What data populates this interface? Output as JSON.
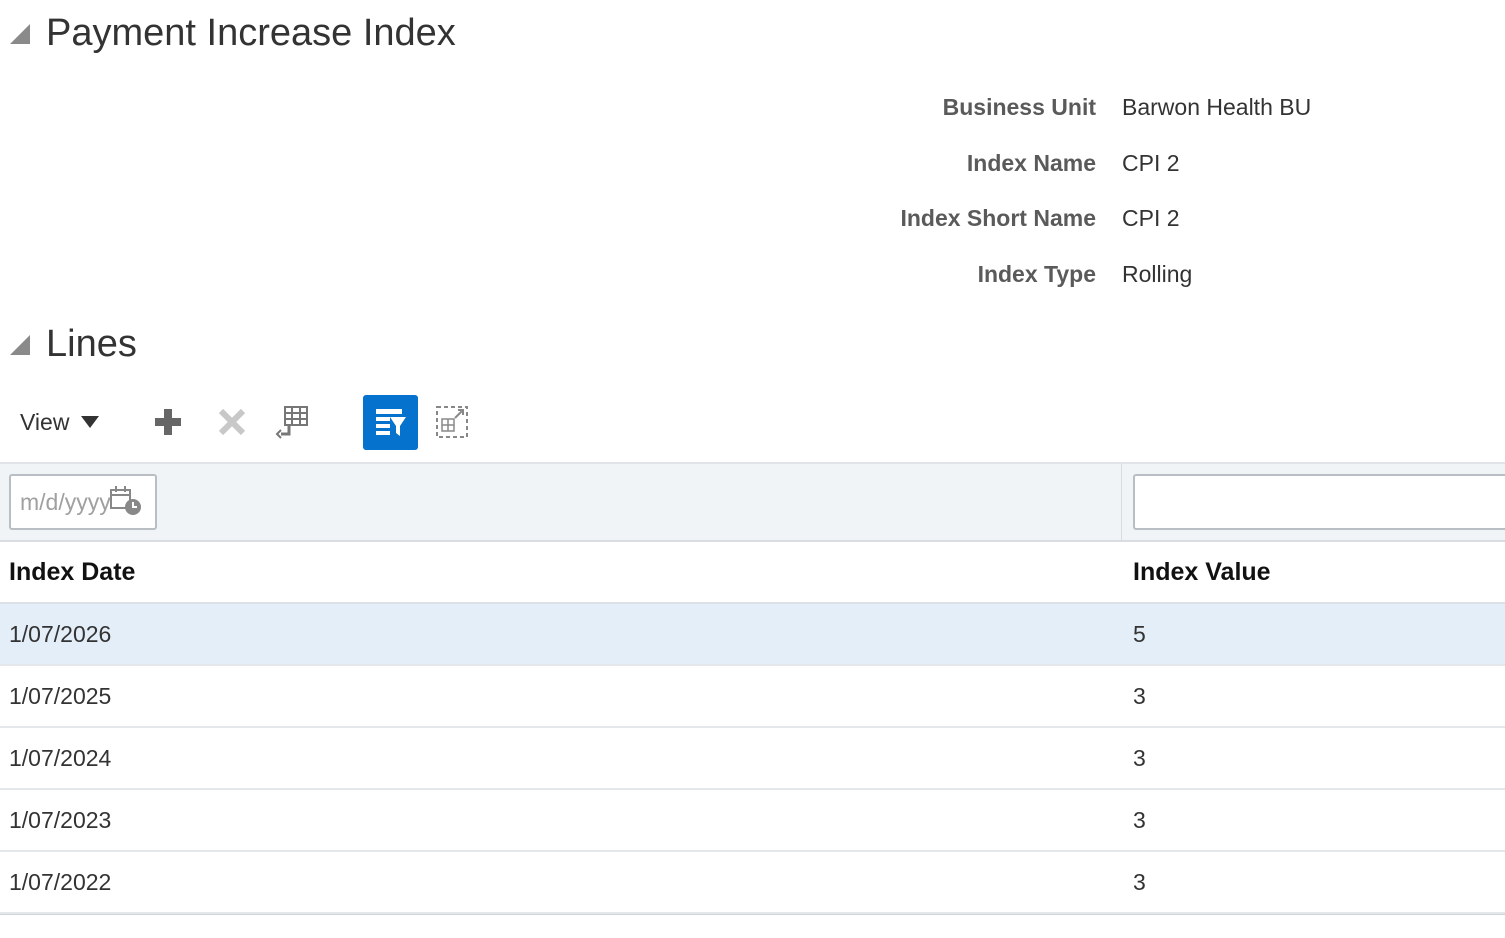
{
  "section1": {
    "title": "Payment Increase Index"
  },
  "form": [
    {
      "label": "Business Unit",
      "value": "Barwon Health BU"
    },
    {
      "label": "Index Name",
      "value": "CPI 2"
    },
    {
      "label": "Index Short Name",
      "value": "CPI 2"
    },
    {
      "label": "Index Type",
      "value": "Rolling"
    }
  ],
  "section2": {
    "title": "Lines"
  },
  "toolbar": {
    "view_label": "View",
    "icons": [
      "add-icon",
      "delete-icon",
      "freeze-icon",
      "query-by-example-icon",
      "detach-icon"
    ]
  },
  "filters": {
    "date_placeholder": "m/d/yyyy",
    "value": ""
  },
  "table": {
    "columns": [
      "Index Date",
      "Index Value"
    ],
    "rows": [
      {
        "date": "1/07/2026",
        "value": "5"
      },
      {
        "date": "1/07/2025",
        "value": "3"
      },
      {
        "date": "1/07/2024",
        "value": "3"
      },
      {
        "date": "1/07/2023",
        "value": "3"
      },
      {
        "date": "1/07/2022",
        "value": "3"
      }
    ],
    "selected_row": 0
  },
  "colors": {
    "accent": "#0572ce",
    "selected_row": "#e4eef8",
    "filter_bg": "#f1f4f7"
  }
}
